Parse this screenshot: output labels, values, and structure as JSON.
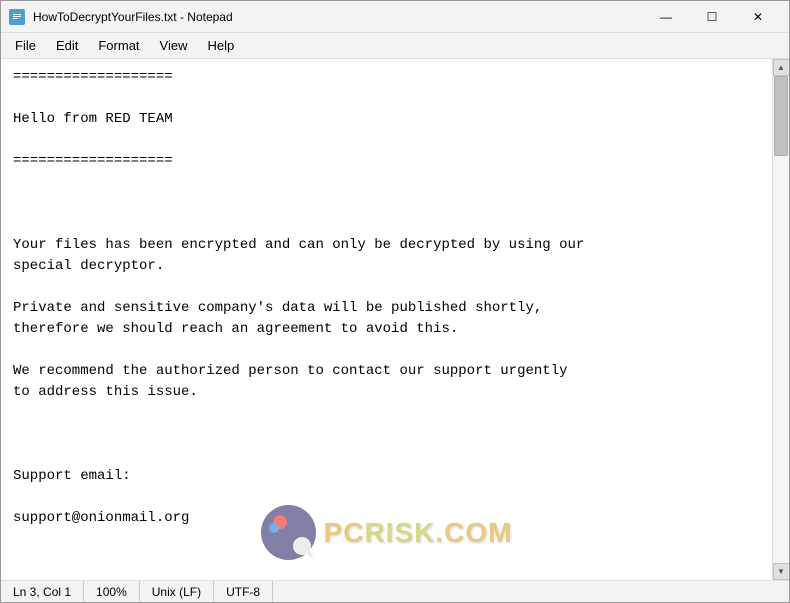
{
  "window": {
    "title": "HowToDecryptYourFiles.txt - Notepad",
    "icon_label": "N"
  },
  "titlebar": {
    "minimize_label": "—",
    "maximize_label": "☐",
    "close_label": "✕"
  },
  "menubar": {
    "items": [
      {
        "label": "File",
        "id": "file"
      },
      {
        "label": "Edit",
        "id": "edit"
      },
      {
        "label": "Format",
        "id": "format"
      },
      {
        "label": "View",
        "id": "view"
      },
      {
        "label": "Help",
        "id": "help"
      }
    ]
  },
  "editor": {
    "content": "===================\n\nHello from RED TEAM\n\n===================\n\n\n\nYour files has been encrypted and can only be decrypted by using our\nspecial decryptor.\n\nPrivate and sensitive company's data will be published shortly,\ntherefore we should reach an agreement to avoid this.\n\nWe recommend the authorized person to contact our support urgently\nto address this issue.\n\n\n\nSupport email:\n\nsupport@onionmail.org"
  },
  "statusbar": {
    "position": "Ln 3, Col 1",
    "zoom": "100%",
    "line_ending": "Unix (LF)",
    "encoding": "UTF-8"
  },
  "watermark": {
    "text_pc": "PC",
    "text_risk": "RISK",
    "text_com": ".COM"
  }
}
